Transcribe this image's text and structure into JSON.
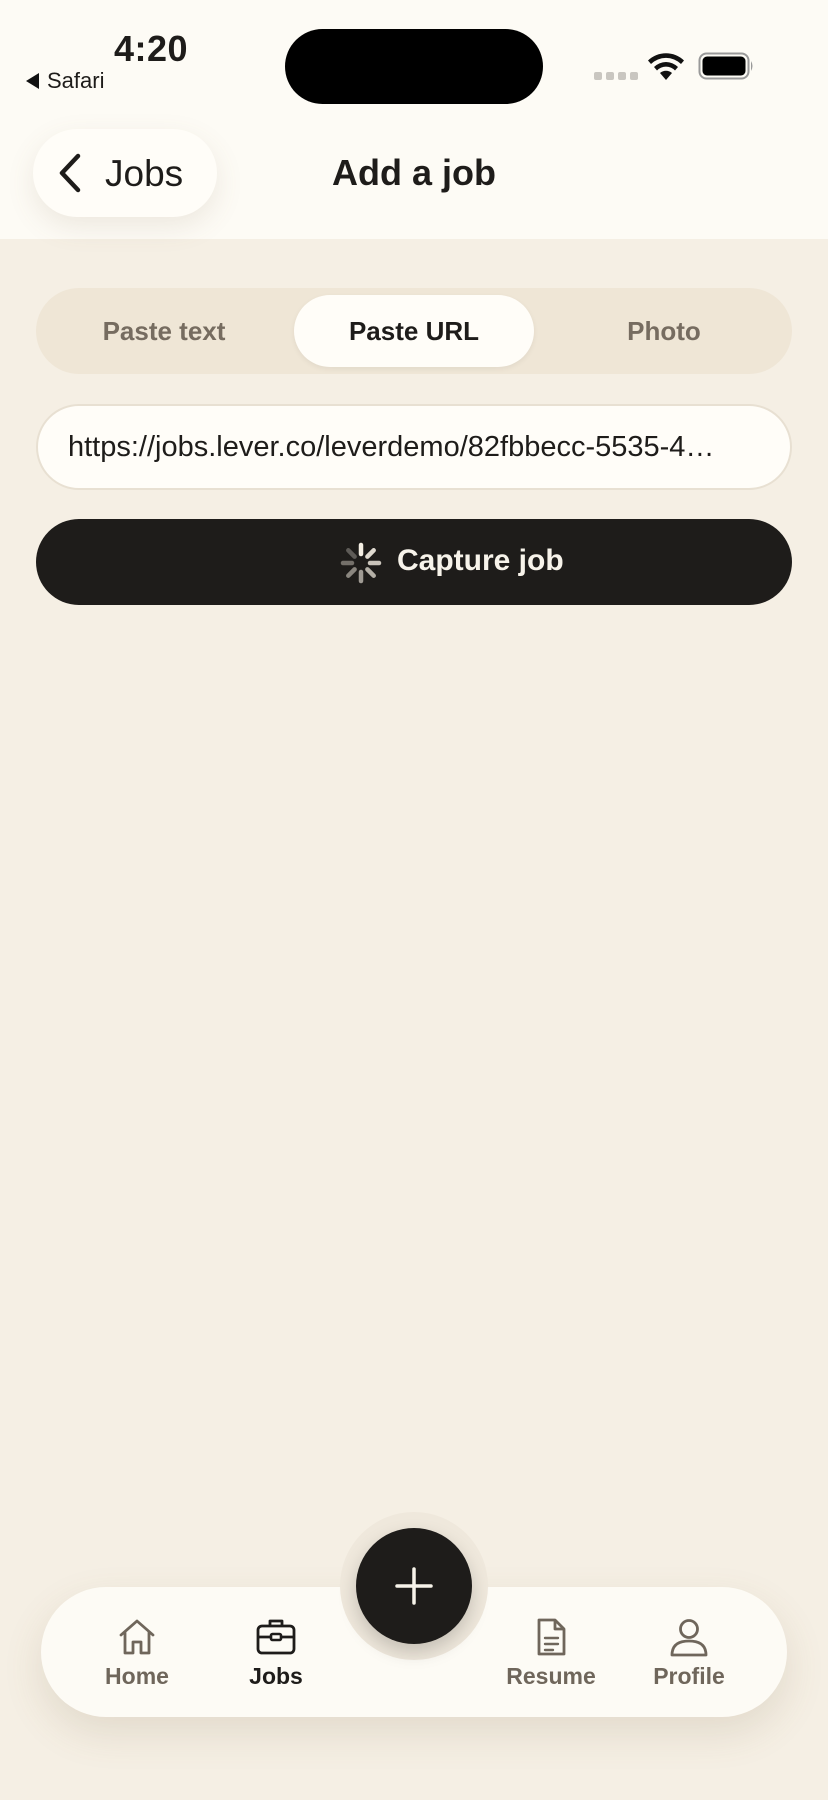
{
  "status_bar": {
    "time": "4:20",
    "back_app": "Safari",
    "icons": [
      "cellular-signal-icon",
      "wifi-icon",
      "battery-icon"
    ]
  },
  "header": {
    "back_label": "Jobs",
    "title": "Add a job"
  },
  "tabs": [
    {
      "label": "Paste text",
      "selected": false
    },
    {
      "label": "Paste URL",
      "selected": true
    },
    {
      "label": "Photo",
      "selected": false
    }
  ],
  "url_input": {
    "value": "https://jobs.lever.co/leverdemo/82fbbecc-5535-4…"
  },
  "capture_button": {
    "label": "Capture job",
    "state": "loading"
  },
  "bottom_nav": {
    "items": [
      {
        "label": "Home",
        "icon": "house-icon",
        "active": false
      },
      {
        "label": "Jobs",
        "icon": "briefcase-icon",
        "active": true
      },
      {
        "label": "Resume",
        "icon": "document-icon",
        "active": false
      },
      {
        "label": "Profile",
        "icon": "person-icon",
        "active": false
      }
    ],
    "fab_icon": "plus-icon"
  },
  "colors": {
    "background": "#f5efe4",
    "surface": "#fdfbf5",
    "primary_dark": "#1e1c1a",
    "muted_text": "#6f665b"
  }
}
